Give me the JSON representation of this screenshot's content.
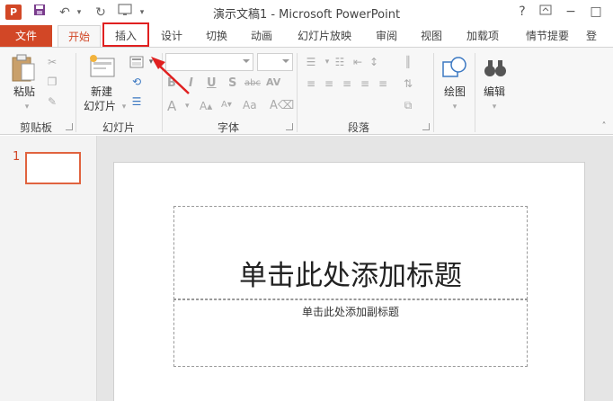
{
  "window": {
    "app_icon": "P",
    "title": "演示文稿1 - Microsoft PowerPoint",
    "help": "?"
  },
  "tabs": [
    {
      "label": "文件"
    },
    {
      "label": "开始"
    },
    {
      "label": "插入"
    },
    {
      "label": "设计"
    },
    {
      "label": "切换"
    },
    {
      "label": "动画"
    },
    {
      "label": "幻灯片放映"
    },
    {
      "label": "审阅"
    },
    {
      "label": "视图"
    },
    {
      "label": "加载项"
    },
    {
      "label": "情节提要"
    },
    {
      "label": "登"
    }
  ],
  "ribbon": {
    "clipboard": {
      "paste": "粘贴",
      "group": "剪贴板"
    },
    "slides": {
      "new_slide_line1": "新建",
      "new_slide_line2": "幻灯片",
      "group": "幻灯片"
    },
    "font": {
      "group": "字体",
      "bold": "B",
      "italic": "I",
      "underline": "U",
      "shadow": "S",
      "strike": "abc",
      "spacing": "AV",
      "font_color": "A",
      "case": "Aa"
    },
    "paragraph": {
      "group": "段落"
    },
    "drawing": {
      "label": "绘图"
    },
    "editing": {
      "label": "编辑"
    }
  },
  "thumbnails": [
    {
      "number": "1"
    }
  ],
  "slide": {
    "title_placeholder": "单击此处添加标题",
    "subtitle_placeholder": "单击此处添加副标题"
  },
  "colors": {
    "accent": "#d24726",
    "highlight_box": "#e02020"
  }
}
